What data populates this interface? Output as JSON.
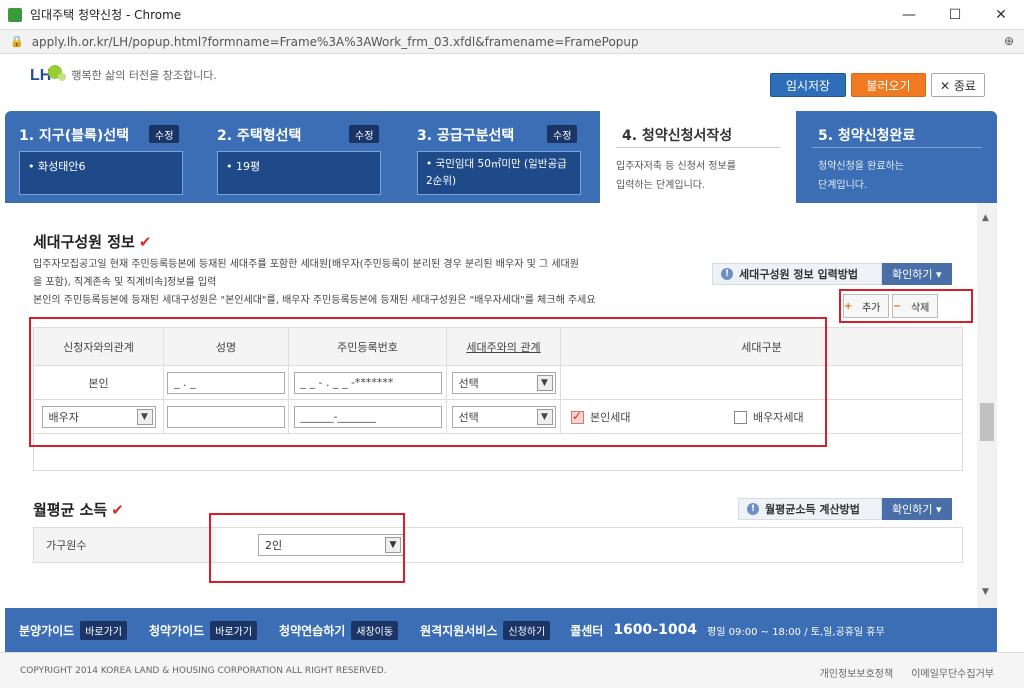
{
  "window": {
    "title": "임대주택 청약신청 - Chrome",
    "url": "apply.lh.or.kr/LH/popup.html?formname=Frame%3A%3AWork_frm_03.xfdl&framename=FramePopup",
    "controls": {
      "minimize": "—",
      "maximize": "☐",
      "close": "✕"
    }
  },
  "header": {
    "logo_text": "LH",
    "slogan": "행복한 삶의 터전을 창조합니다.",
    "save_temp": "임시저장",
    "load": "불러오기",
    "close": "✕ 종료"
  },
  "steps": [
    {
      "title": "1. 지구(블록)선택",
      "modify": "수정",
      "value": "• 화성태안6"
    },
    {
      "title": "2. 주택형선택",
      "modify": "수정",
      "value": "• 19평"
    },
    {
      "title": "3. 공급구분선택",
      "modify": "수정",
      "value": "• 국민임대 50㎡미만 (일반공급 2순위)"
    },
    {
      "title": "4. 청약신청서작성",
      "desc1": "입주자저축 등 신청서 정보를",
      "desc2": "입력하는 단계입니다."
    },
    {
      "title": "5. 청약신청완료",
      "desc1": "청약신청을 완료하는",
      "desc2": "단계입니다."
    }
  ],
  "household": {
    "title": "세대구성원 정보",
    "check": "✔",
    "note1": "입주자모집공고일 현재 주민등록등본에 등재된 세대주를 포함한 세대원[배우자(주민등록이 분리된 경우 분리된 배우자 및 그 세대원",
    "note2": "을 포함), 직계존속 및 직계비속]정보를 입력",
    "note3": "본인의 주민등록등본에 등재된 세대구성원은 \"본인세대\"를, 배우자 주민등록등본에 등재된 세대구성원은 \"배우자세대\"를 체크해 주세요",
    "info_btn": "세대구성원 정보 입력방법",
    "confirm_btn": "확인하기 ▾",
    "add_btn": "추가",
    "del_btn": "삭제",
    "headers": [
      "신청자와의관계",
      "성명",
      "주민등록번호",
      "세대주와의 관계",
      "세대구분"
    ],
    "row1": {
      "relation": "본인",
      "name": "_ . _",
      "rrn": "_ _ - . _ _ -*******",
      "head_rel": "선택"
    },
    "row2": {
      "relation": "배우자",
      "name": "",
      "rrn": "______-_______",
      "head_rel": "선택",
      "opt_self": "본인세대",
      "opt_spouse": "배우자세대"
    }
  },
  "income": {
    "title": "월평균 소득",
    "check": "✔",
    "info_btn": "월평균소득 계산방법",
    "confirm_btn": "확인하기 ▾",
    "label": "가구원수",
    "value": "2인"
  },
  "footer": {
    "nav": [
      {
        "label": "분양가이드",
        "go": "바로가기"
      },
      {
        "label": "청약가이드",
        "go": "바로가기"
      },
      {
        "label": "청약연습하기",
        "go": "새창이동"
      },
      {
        "label": "원격지원서비스",
        "go": "신청하기"
      }
    ],
    "call_label": "콜센터",
    "call_number": "1600-1004",
    "hours": "평일 09:00 ~ 18:00 / 토,일,공휴일 휴무",
    "copyright": "COPYRIGHT 2014 KOREA LAND & HOUSING CORPORATION ALL RIGHT RESERVED.",
    "link1": "개인정보보호정책",
    "link2": "이메일무단수집거부"
  },
  "colors": {
    "brand_blue": "#3b6eb5",
    "orange": "#f07a22",
    "highlight_red": "#d61f2c"
  }
}
